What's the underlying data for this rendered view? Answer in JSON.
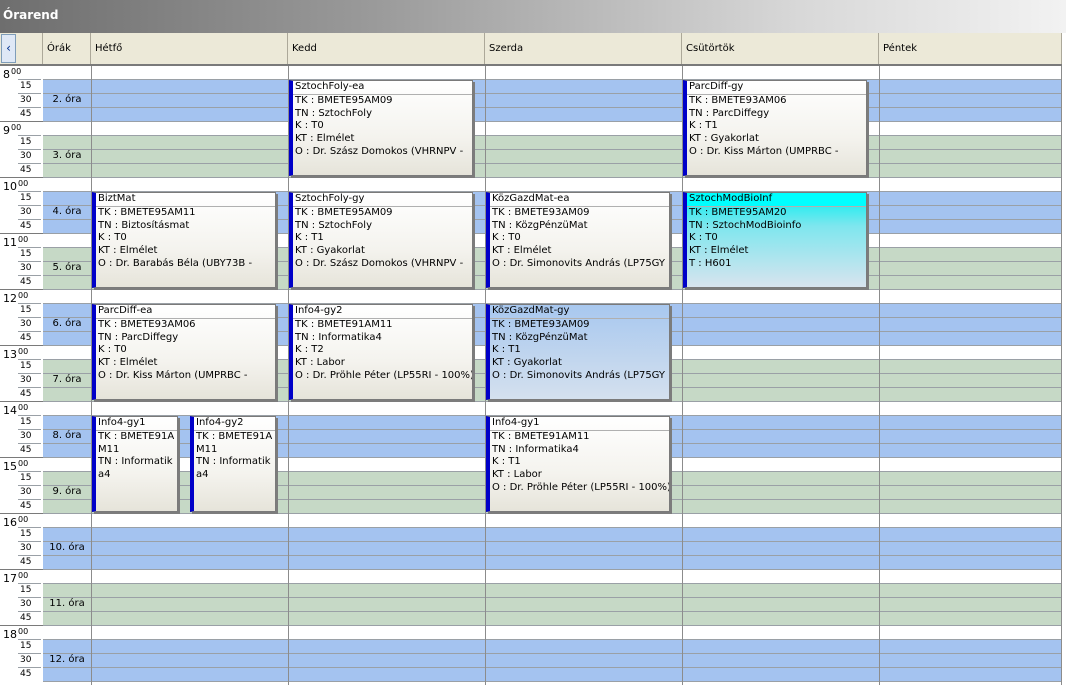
{
  "window": {
    "title": "Órarend"
  },
  "nav": {
    "prev_icon": "‹"
  },
  "columns": [
    "Órák",
    "Hétfő",
    "Kedd",
    "Szerda",
    "Csütörtök",
    "Péntek"
  ],
  "hours": [
    "8",
    "9",
    "10",
    "11",
    "12",
    "13",
    "14",
    "15",
    "16",
    "17",
    "18"
  ],
  "hour_suffix": "00",
  "minutes": [
    "15",
    "30",
    "45"
  ],
  "periods": [
    "2. óra",
    "3. óra",
    "4. óra",
    "5. óra",
    "6. óra",
    "7. óra",
    "8. óra",
    "9. óra",
    "10. óra",
    "11. óra",
    "12. óra"
  ],
  "colors": {
    "period_blue": "#a4c3f0",
    "period_green": "#c6d9c6",
    "event_marker": "#0000c8",
    "highlight_cyan": "#00ffff"
  },
  "events": [
    {
      "id": "e1",
      "title": "SztochFoly-ea",
      "lines": [
        "TK : BMETE95AM09",
        "TN : SztochFoly",
        "K : T0",
        "KT : Elmélet",
        "O :  Dr. Szász Domokos (VHRNPV -"
      ]
    },
    {
      "id": "e2",
      "title": "ParcDiff-gy",
      "lines": [
        "TK : BMETE93AM06",
        "TN : ParcDiffegy",
        "K : T1",
        "KT : Gyakorlat",
        "O :  Dr. Kiss Márton (UMPRBC -"
      ]
    },
    {
      "id": "e3",
      "title": "BiztMat",
      "lines": [
        "TK : BMETE95AM11",
        "TN : Biztosításmat",
        "K : T0",
        "KT : Elmélet",
        "O :  Dr. Barabás Béla (UBY73B -"
      ]
    },
    {
      "id": "e4",
      "title": "SztochFoly-gy",
      "lines": [
        "TK : BMETE95AM09",
        "TN : SztochFoly",
        "K : T1",
        "KT : Gyakorlat",
        "O :  Dr. Szász Domokos (VHRNPV -"
      ]
    },
    {
      "id": "e5",
      "title": "KözGazdMat-ea",
      "lines": [
        "TK : BMETE93AM09",
        "TN : KözgPénzüMat",
        "K : T0",
        "KT : Elmélet",
        "O :  Dr. Simonovits András (LP75GY"
      ]
    },
    {
      "id": "e6",
      "title": "SztochModBioInf",
      "lines": [
        "TK : BMETE95AM20",
        "TN : SztochModBioinfo",
        "K : T0",
        "KT : Elmélet",
        "T : H601"
      ]
    },
    {
      "id": "e7",
      "title": "ParcDiff-ea",
      "lines": [
        "TK : BMETE93AM06",
        "TN : ParcDiffegy",
        "K : T0",
        "KT : Elmélet",
        "O :  Dr. Kiss Márton (UMPRBC -"
      ]
    },
    {
      "id": "e8",
      "title": "Info4-gy2",
      "lines": [
        "TK : BMETE91AM11",
        "TN : Informatika4",
        "K : T2",
        "KT : Labor",
        "O :  Dr. Pröhle Péter (LP55RI - 100%)"
      ]
    },
    {
      "id": "e9",
      "title": "KözGazdMat-gy",
      "lines": [
        "TK : BMETE93AM09",
        "TN : KözgPénzüMat",
        "K : T1",
        "KT : Gyakorlat",
        "O :  Dr. Simonovits András (LP75GY"
      ]
    },
    {
      "id": "e10",
      "title": "Info4-gy1",
      "lines": [
        "TK : BMETE91AM11",
        "TN : Informatika4"
      ]
    },
    {
      "id": "e11",
      "title": "Info4-gy2",
      "lines": [
        "TK : BMETE91AM11",
        "TN : Informatika4"
      ]
    },
    {
      "id": "e12",
      "title": "Info4-gy1",
      "lines": [
        "TK : BMETE91AM11",
        "TN : Informatika4",
        "K : T1",
        "KT : Labor",
        "O :  Dr. Pröhle Péter (LP55RI - 100%)"
      ]
    }
  ]
}
